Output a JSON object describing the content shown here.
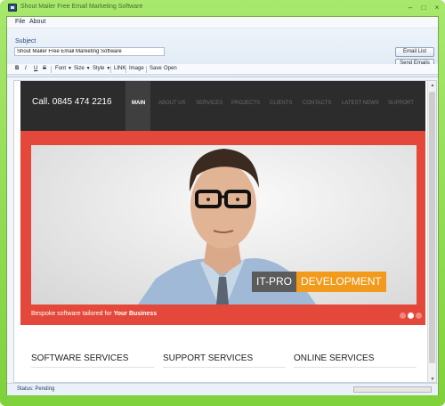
{
  "window": {
    "title": "Shout Mailer Free Email Marketing Software",
    "min": "–",
    "max": "□",
    "close": "×"
  },
  "menu": {
    "file": "File",
    "about": "About"
  },
  "subject": {
    "label": "Subject",
    "value": "Shout Mailer Free Email Marketing Software"
  },
  "buttons": {
    "email_list": "Email List",
    "send_emails": "Send Emails"
  },
  "toolbar": {
    "bold": "B",
    "italic": "I",
    "underline": "U",
    "strike": "S",
    "font": "Font",
    "size": "Size",
    "style": "Style",
    "link": "LINK",
    "image": "Image",
    "save": "Save",
    "open": "Open"
  },
  "site": {
    "phone": "Call. 0845 474 2216",
    "nav": [
      "MAIN",
      "ABOUT US",
      "SERVICES",
      "PROJECTS",
      "CLIENTS",
      "CONTACTS",
      "LATEST NEWS",
      "SUPPORT"
    ],
    "badge_left": "IT-PRO",
    "badge_right": "DEVELOPMENT",
    "tagline_prefix": "Bespoke software tailored for ",
    "tagline_bold": "Your Business",
    "services": [
      "SOFTWARE SERVICES",
      "SUPPORT SERVICES",
      "ONLINE SERVICES"
    ]
  },
  "status": {
    "text": "Status: Pending",
    "progress": 0
  },
  "colors": {
    "frame": "#7fd23b",
    "hero": "#e4483a",
    "badge_accent": "#f19a1b",
    "header": "#2c2c2c"
  }
}
